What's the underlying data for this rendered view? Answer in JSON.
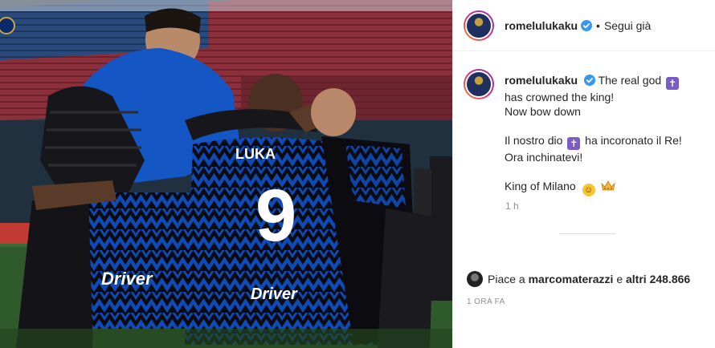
{
  "header": {
    "username": "romelulukaku",
    "separator": "•",
    "follow_label": "Segui già",
    "more_label": "···"
  },
  "caption": {
    "username": "romelulukaku",
    "line1_a": "The real god",
    "line2": "has crowned the king!",
    "line3": "Now bow down",
    "line4_a": "Il nostro dio",
    "line4_b": "ha incoronato il Re!",
    "line5": "Ora inchinatevi!",
    "line6": "King of Milano",
    "cross_glyph": "✝",
    "smile_glyph": "☺",
    "time": "1 h"
  },
  "likes": {
    "prefix": "Piace a",
    "user": "marcomaterazzi",
    "middle": "e",
    "others": "altri 248.866"
  },
  "date": "1 ORA FA",
  "photo": {
    "jersey_number": "9",
    "jersey_name": "LUKA",
    "sponsor": "Driver",
    "corner_logo": "I"
  },
  "colors": {
    "verified": "#3897f0",
    "inter_blue": "#0a3d9e",
    "inter_black": "#0c0c10"
  }
}
